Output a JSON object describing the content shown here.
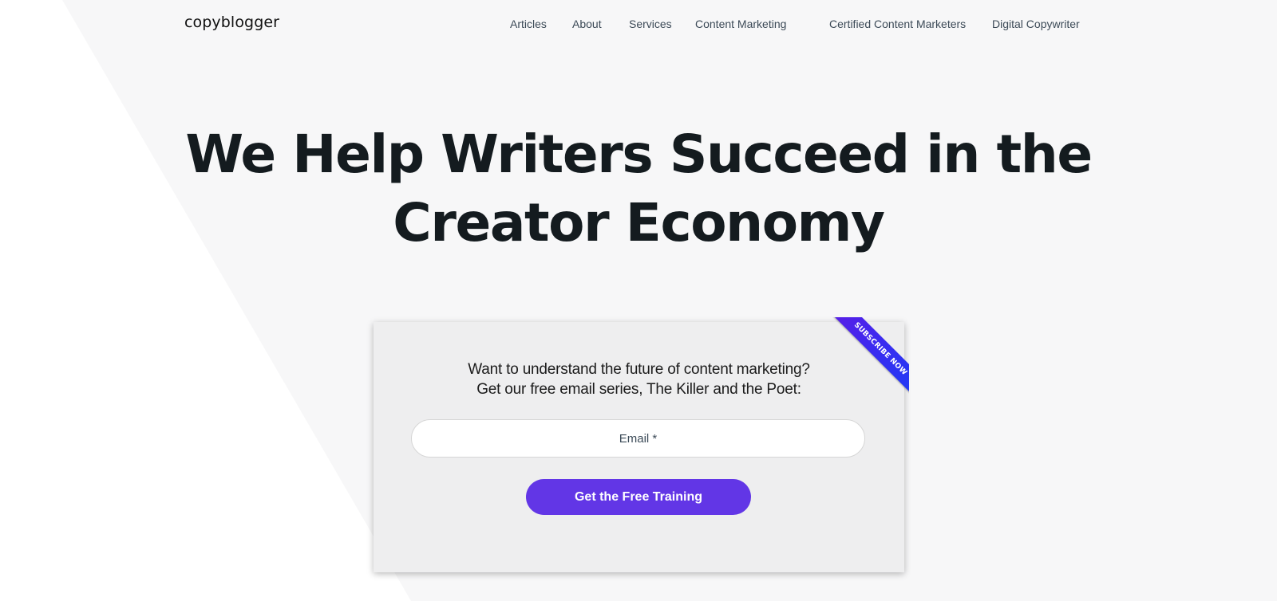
{
  "header": {
    "logo": "copyblogger",
    "nav": [
      {
        "label": "Articles"
      },
      {
        "label": "About"
      },
      {
        "label": "Services"
      },
      {
        "label": "Content Marketing"
      },
      {
        "label": "Certified Content Marketers"
      },
      {
        "label": "Digital Copywriter"
      }
    ]
  },
  "hero": {
    "title_line1": "We Help Writers Succeed in the",
    "title_line2": "Creator Economy"
  },
  "signup": {
    "ribbon": "SUBSCRIBE NOW",
    "text_line1": "Want to understand the future of content marketing?",
    "text_line2": "Get our free email series, The Killer and the Poet:",
    "email_placeholder": "Email *",
    "email_value": "",
    "button_label": "Get the Free Training"
  },
  "colors": {
    "accent": "#6236e6",
    "background": "#f7f7f8",
    "card": "#eeeeef",
    "heading": "#141b1f"
  }
}
